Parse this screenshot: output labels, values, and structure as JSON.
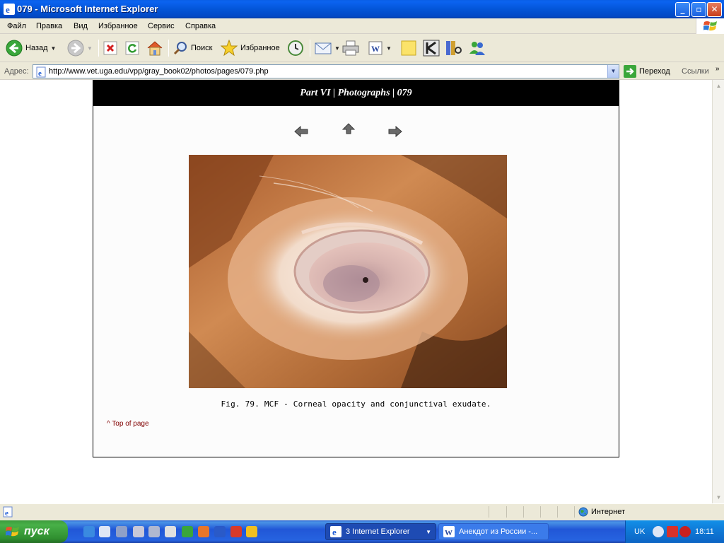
{
  "window": {
    "title": "079 - Microsoft Internet Explorer"
  },
  "menu": [
    "Файл",
    "Правка",
    "Вид",
    "Избранное",
    "Сервис",
    "Справка"
  ],
  "toolbar": {
    "back_label": "Назад",
    "search_label": "Поиск",
    "favorites_label": "Избранное"
  },
  "address": {
    "label": "Адрес:",
    "url": "http://www.vet.uga.edu/vpp/gray_book02/photos/pages/079.php",
    "go_label": "Переход",
    "links_label": "Ссылки"
  },
  "page": {
    "header": "Part VI | Photographs | 079",
    "caption": "Fig. 79.  MCF - Corneal opacity and conjunctival exudate.",
    "top_link": "^ Top of page"
  },
  "status": {
    "zone": "Интернет"
  },
  "taskbar": {
    "start_label": "пуск",
    "ie_button": "3 Internet Explorer",
    "word_button": "Анекдот из России -...",
    "language": "UK",
    "clock": "18:11"
  },
  "colors": {
    "titlebar": "#0355d8",
    "taskbar": "#2157d7",
    "start": "#3c9c3c",
    "link": "#800000"
  }
}
